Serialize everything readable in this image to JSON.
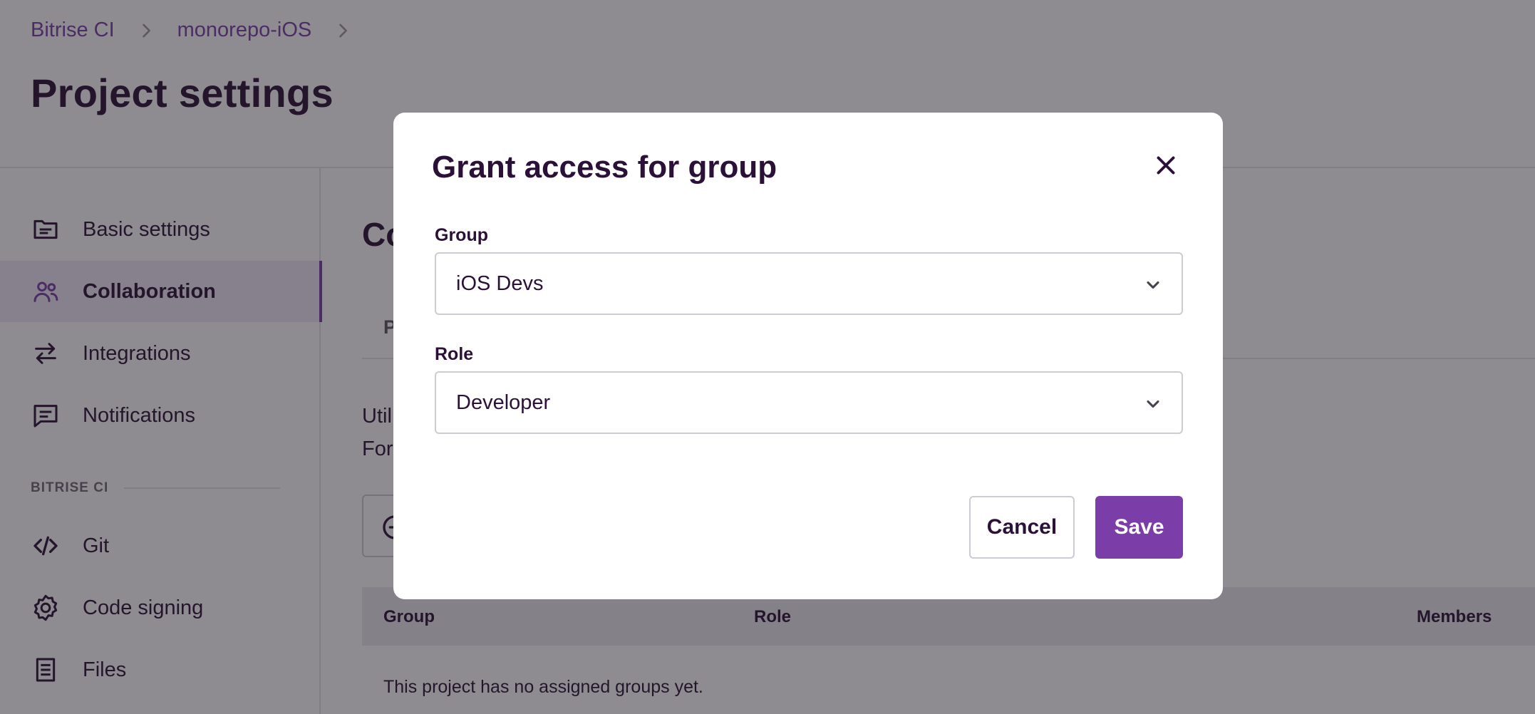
{
  "breadcrumb": {
    "items": [
      "Bitrise CI",
      "monorepo-iOS"
    ]
  },
  "page": {
    "title": "Project settings"
  },
  "sidebar": {
    "items": [
      {
        "label": "Basic settings",
        "icon": "folder-icon"
      },
      {
        "label": "Collaboration",
        "icon": "users-icon",
        "active": true
      },
      {
        "label": "Integrations",
        "icon": "swap-arrows-icon"
      },
      {
        "label": "Notifications",
        "icon": "message-icon"
      }
    ],
    "section_label": "BITRISE CI",
    "section_items": [
      {
        "label": "Git",
        "icon": "code-icon"
      },
      {
        "label": "Code signing",
        "icon": "badge-icon"
      },
      {
        "label": "Files",
        "icon": "document-icon"
      }
    ]
  },
  "content": {
    "heading_partial": "Co",
    "tab_partial": "P",
    "text_line1_partial": "Util",
    "text_line2_partial": "For",
    "table": {
      "columns": [
        "Group",
        "Role",
        "Members"
      ],
      "empty_text": "This project has no assigned groups yet."
    }
  },
  "modal": {
    "title": "Grant access for group",
    "group_label": "Group",
    "group_value": "iOS Devs",
    "role_label": "Role",
    "role_value": "Developer",
    "cancel_label": "Cancel",
    "save_label": "Save"
  },
  "colors": {
    "accent": "#7b3ea8",
    "text": "#2b1137",
    "overlay": "rgba(30,26,34,0.5)"
  }
}
